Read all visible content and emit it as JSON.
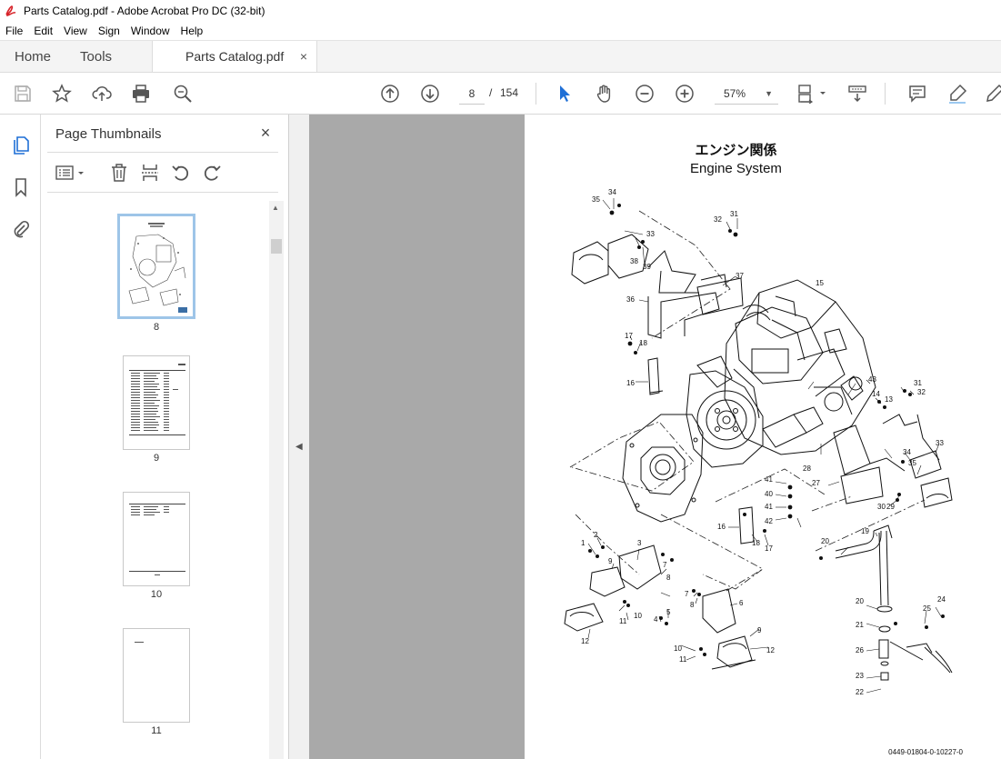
{
  "window": {
    "title": "Parts Catalog.pdf - Adobe Acrobat Pro DC (32-bit)"
  },
  "menu": [
    "File",
    "Edit",
    "View",
    "Sign",
    "Window",
    "Help"
  ],
  "tabs": {
    "home": "Home",
    "tools": "Tools",
    "document": "Parts Catalog.pdf",
    "close_glyph": "×"
  },
  "toolbar": {
    "current_page": "8",
    "page_separator": "/",
    "total_pages": "154",
    "zoom": "57%",
    "icons": [
      "save-icon",
      "star-icon",
      "upload-icon",
      "print-icon",
      "zoom-search-icon",
      "page-up-icon",
      "page-down-icon",
      "select-cursor-icon",
      "hand-icon",
      "zoom-out-icon",
      "zoom-in-icon",
      "fit-page-icon",
      "scroll-mode-icon",
      "comment-icon",
      "highlight-icon",
      "pen-icon"
    ]
  },
  "panel": {
    "title": "Page Thumbnails",
    "close_glyph": "×",
    "thumbnails": [
      {
        "number": "8",
        "selected": true
      },
      {
        "number": "9",
        "selected": false
      },
      {
        "number": "10",
        "selected": false
      },
      {
        "number": "11",
        "selected": false
      }
    ]
  },
  "document": {
    "title_jp": "エンジン関係",
    "title_en": "Engine System",
    "code": "0449-01804-0-10227-0",
    "callouts": [
      "1",
      "2",
      "3",
      "4",
      "5",
      "6",
      "7",
      "7",
      "8",
      "8",
      "9",
      "9",
      "10",
      "10",
      "11",
      "11",
      "12",
      "12",
      "13",
      "14",
      "15",
      "16",
      "16",
      "17",
      "17",
      "18",
      "18",
      "19",
      "20",
      "20",
      "21",
      "22",
      "23",
      "24",
      "25",
      "26",
      "27",
      "28",
      "29",
      "30",
      "31",
      "31",
      "32",
      "32",
      "33",
      "33",
      "34",
      "34",
      "35",
      "35",
      "36",
      "37",
      "38",
      "39",
      "40",
      "41",
      "41",
      "42",
      "43"
    ]
  }
}
